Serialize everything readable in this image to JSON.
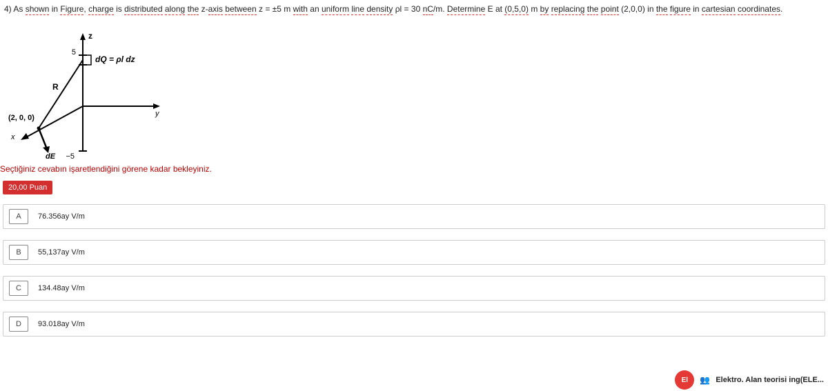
{
  "question": {
    "text_parts": [
      "4) As ",
      "shown",
      " in ",
      "Figure",
      ", ",
      "charge",
      " is ",
      "distributed",
      " ",
      "along",
      " ",
      "the",
      " z-",
      "axis",
      " ",
      "between",
      " z = ±5 m ",
      "with",
      " an ",
      "uniform",
      " ",
      "line",
      " ",
      "density",
      " ρ",
      "l",
      " = 30 ",
      "nC",
      "/m. ",
      "Determine",
      " E at ",
      "(0,5,0)",
      " m ",
      "by",
      " ",
      "replacing",
      " ",
      "the",
      " ",
      "point",
      " (2,0,0) in ",
      "the",
      " ",
      "figure",
      " in ",
      "cartesian",
      " ",
      "coordinates",
      "."
    ],
    "underline_flags": [
      0,
      1,
      0,
      1,
      0,
      1,
      0,
      1,
      0,
      1,
      0,
      1,
      0,
      1,
      0,
      1,
      0,
      1,
      0,
      1,
      0,
      1,
      0,
      1,
      0,
      0,
      0,
      1,
      0,
      1,
      0,
      1,
      0,
      1,
      0,
      1,
      0,
      1,
      0,
      1,
      0,
      1,
      0,
      1,
      0,
      1,
      0,
      1,
      0
    ]
  },
  "figure": {
    "labels": {
      "z": "z",
      "y": "y",
      "x": "x",
      "top": "5",
      "bottom": "−5",
      "dQ": "dQ = ρl dz",
      "R": "R",
      "point": "(2, 0, 0)",
      "dE": "dE"
    }
  },
  "instruction": "Seçtiğiniz cevabın işaretlendiğini görene kadar bekleyiniz.",
  "points_badge": "20,00 Puan",
  "options": [
    {
      "letter": "A",
      "text": "76.356ay V/m"
    },
    {
      "letter": "B",
      "text": "55,137ay V/m"
    },
    {
      "letter": "C",
      "text": "134.48ay V/m"
    },
    {
      "letter": "D",
      "text": "93.018ay V/m"
    }
  ],
  "footer": {
    "avatar_text": "El",
    "course": "Elektro. Alan teorisi ing(ELE..."
  }
}
